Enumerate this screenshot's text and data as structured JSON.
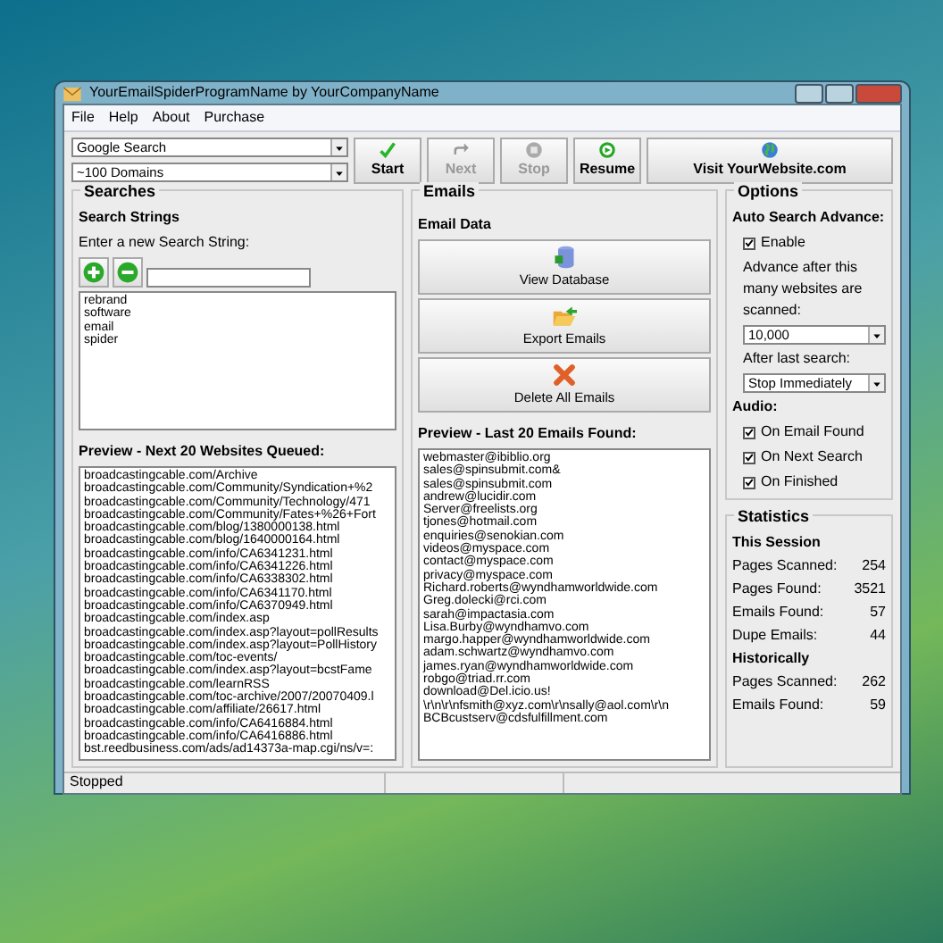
{
  "window": {
    "title": "YourEmailSpiderProgramName by YourCompanyName"
  },
  "menu": [
    "File",
    "Help",
    "About",
    "Purchase"
  ],
  "toolbar": {
    "search_engine": "Google Search",
    "domain_count": "~100 Domains",
    "buttons": [
      {
        "label": "Start",
        "kind": "start",
        "disabled": false
      },
      {
        "label": "Next",
        "kind": "next",
        "disabled": true
      },
      {
        "label": "Stop",
        "kind": "stop",
        "disabled": true
      },
      {
        "label": "Resume",
        "kind": "resume",
        "disabled": false
      },
      {
        "label": "Visit YourWebsite.com",
        "kind": "website",
        "disabled": false
      }
    ]
  },
  "searches": {
    "title": "Searches",
    "heading": "Search Strings",
    "prompt": "Enter a new Search String:",
    "strings": [
      "rebrand",
      "software",
      "email",
      "spider"
    ],
    "preview_label": "Preview - Next 20 Websites Queued:",
    "queued": [
      "broadcastingcable.com/Archive",
      "broadcastingcable.com/Community/Syndication+%2",
      "broadcastingcable.com/Community/Technology/471",
      "broadcastingcable.com/Community/Fates+%26+Fort",
      "broadcastingcable.com/blog/1380000138.html",
      "broadcastingcable.com/blog/1640000164.html",
      "broadcastingcable.com/info/CA6341231.html",
      "broadcastingcable.com/info/CA6341226.html",
      "broadcastingcable.com/info/CA6338302.html",
      "broadcastingcable.com/info/CA6341170.html",
      "broadcastingcable.com/info/CA6370949.html",
      "broadcastingcable.com/index.asp",
      "broadcastingcable.com/index.asp?layout=pollResults",
      "broadcastingcable.com/index.asp?layout=PollHistory",
      "broadcastingcable.com/toc-events/",
      "broadcastingcable.com/index.asp?layout=bcstFame",
      "broadcastingcable.com/learnRSS",
      "broadcastingcable.com/toc-archive/2007/20070409.l",
      "broadcastingcable.com/affiliate/26617.html",
      "broadcastingcable.com/info/CA6416884.html",
      "broadcastingcable.com/info/CA6416886.html",
      "bst.reedbusiness.com/ads/ad14373a-map.cgi/ns/v=:"
    ]
  },
  "emails": {
    "title": "Emails",
    "heading": "Email Data",
    "buttons": [
      {
        "label": "View Database",
        "kind": "database"
      },
      {
        "label": "Export Emails",
        "kind": "export"
      },
      {
        "label": "Delete All Emails",
        "kind": "delete"
      }
    ],
    "preview_label": "Preview - Last 20 Emails Found:",
    "found": [
      "webmaster@ibiblio.org",
      "sales@spinsubmit.com&",
      "sales@spinsubmit.com",
      "andrew@lucidir.com",
      "Server@freelists.org",
      "tjones@hotmail.com",
      "enquiries@senokian.com",
      "videos@myspace.com",
      "contact@myspace.com",
      "privacy@myspace.com",
      "Richard.roberts@wyndhamworldwide.com",
      "Greg.dolecki@rci.com",
      "sarah@impactasia.com",
      "Lisa.Burby@wyndhamvo.com",
      "margo.happer@wyndhamworldwide.com",
      "adam.schwartz@wyndhamvo.com",
      "james.ryan@wyndhamworldwide.com",
      "robgo@triad.rr.com",
      "download@Del.icio.us!",
      "\\r\\n\\r\\nfsmith@xyz.com\\r\\nsally@aol.com\\r\\n",
      "BCBcustserv@cdsfulfillment.com"
    ]
  },
  "options": {
    "title": "Options",
    "auto_heading": "Auto Search Advance:",
    "enable": {
      "label": "Enable",
      "checked": true
    },
    "advance_label": "Advance after this many websites are scanned:",
    "advance_value": "10,000",
    "after_label": "After last search:",
    "after_value": "Stop Immediately",
    "audio_heading": "Audio:",
    "audio": [
      {
        "label": "On Email Found",
        "checked": true
      },
      {
        "label": "On Next Search",
        "checked": true
      },
      {
        "label": "On Finished",
        "checked": true
      }
    ]
  },
  "statistics": {
    "title": "Statistics",
    "groups": [
      {
        "heading": "This Session",
        "rows": [
          {
            "label": "Pages Scanned:",
            "value": "254"
          },
          {
            "label": "Pages Found:",
            "value": "3521"
          },
          {
            "label": "Emails Found:",
            "value": "57"
          },
          {
            "label": "Dupe Emails:",
            "value": "44"
          }
        ]
      },
      {
        "heading": "Historically",
        "rows": [
          {
            "label": "Pages Scanned:",
            "value": "262"
          },
          {
            "label": "Emails Found:",
            "value": "59"
          }
        ]
      }
    ]
  },
  "status_bar": "Stopped"
}
